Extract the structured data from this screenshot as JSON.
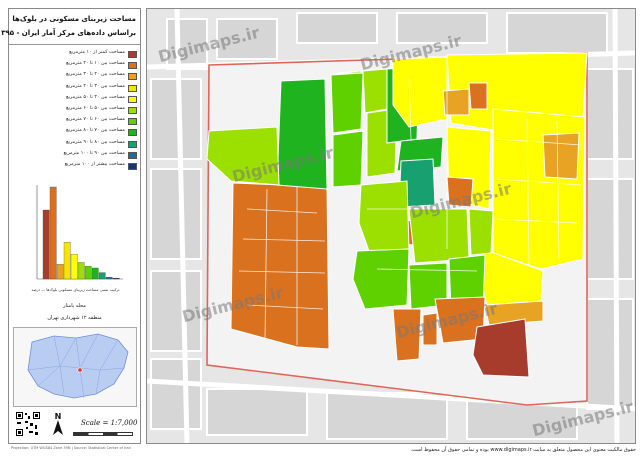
{
  "title": {
    "line1": "مساحت زیربنای مسکونی در بلوک‌ها",
    "line2": "براساس داده‌های مرکز آمار ایران - ۱۳۹۵"
  },
  "legend": {
    "items": [
      {
        "label": "مساحت کمتر از ۱۰ مترمربع",
        "color": "#a83c2c"
      },
      {
        "label": "مساحت بین ۱۰ تا ۲۰ مترمربع",
        "color": "#d9711f"
      },
      {
        "label": "مساحت بین ۲۰ تا ۳۰ مترمربع",
        "color": "#e8a324"
      },
      {
        "label": "مساحت بین ۳۰ تا ۴۰ مترمربع",
        "color": "#f4e600"
      },
      {
        "label": "مساحت بین ۴۰ تا ۵۰ مترمربع",
        "color": "#ffff00"
      },
      {
        "label": "مساحت بین ۵۰ تا ۶۰ مترمربع",
        "color": "#9be000"
      },
      {
        "label": "مساحت بین ۶۰ تا ۷۰ مترمربع",
        "color": "#5fd100"
      },
      {
        "label": "مساحت بین ۷۰ تا ۸۰ مترمربع",
        "color": "#1fb31f"
      },
      {
        "label": "مساحت بین ۸۰ تا ۹۰ مترمربع",
        "color": "#18a070"
      },
      {
        "label": "مساحت بین ۹۰ تا ۱۰۰ مترمربع",
        "color": "#1d6aa0"
      },
      {
        "label": "مساحت بیشتر از ۱۰۰ مترمربع",
        "color": "#12386d"
      }
    ]
  },
  "histogram": {
    "values": [
      75,
      100,
      16,
      40,
      27,
      18,
      14,
      12,
      7,
      2,
      1
    ],
    "caption": "ترکیب نسبی مساحت زیربنای مسکونی بلوک‌ها — درصد"
  },
  "inset": {
    "title": "محله پامنار",
    "subtitle": "منطقه ۱۲ شهرداری تهران"
  },
  "scale": {
    "label": "Scale = 1:7,000"
  },
  "credit": {
    "text": "Projection: UTM WGS84 Zone 39N | Source: Statistical Center of Iran"
  },
  "footer": {
    "text": "حقوق مالکیت معنوی این محصول متعلق به سایت www.digimaps.ir بوده و تمامی حقوق آن محفوظ است."
  },
  "watermark": {
    "text": "Digimaps.ir"
  },
  "colors": {
    "boundary": "#e0645a",
    "street": "#ffffff",
    "base": "#e8e8e8",
    "block": "#d9d9d9"
  }
}
